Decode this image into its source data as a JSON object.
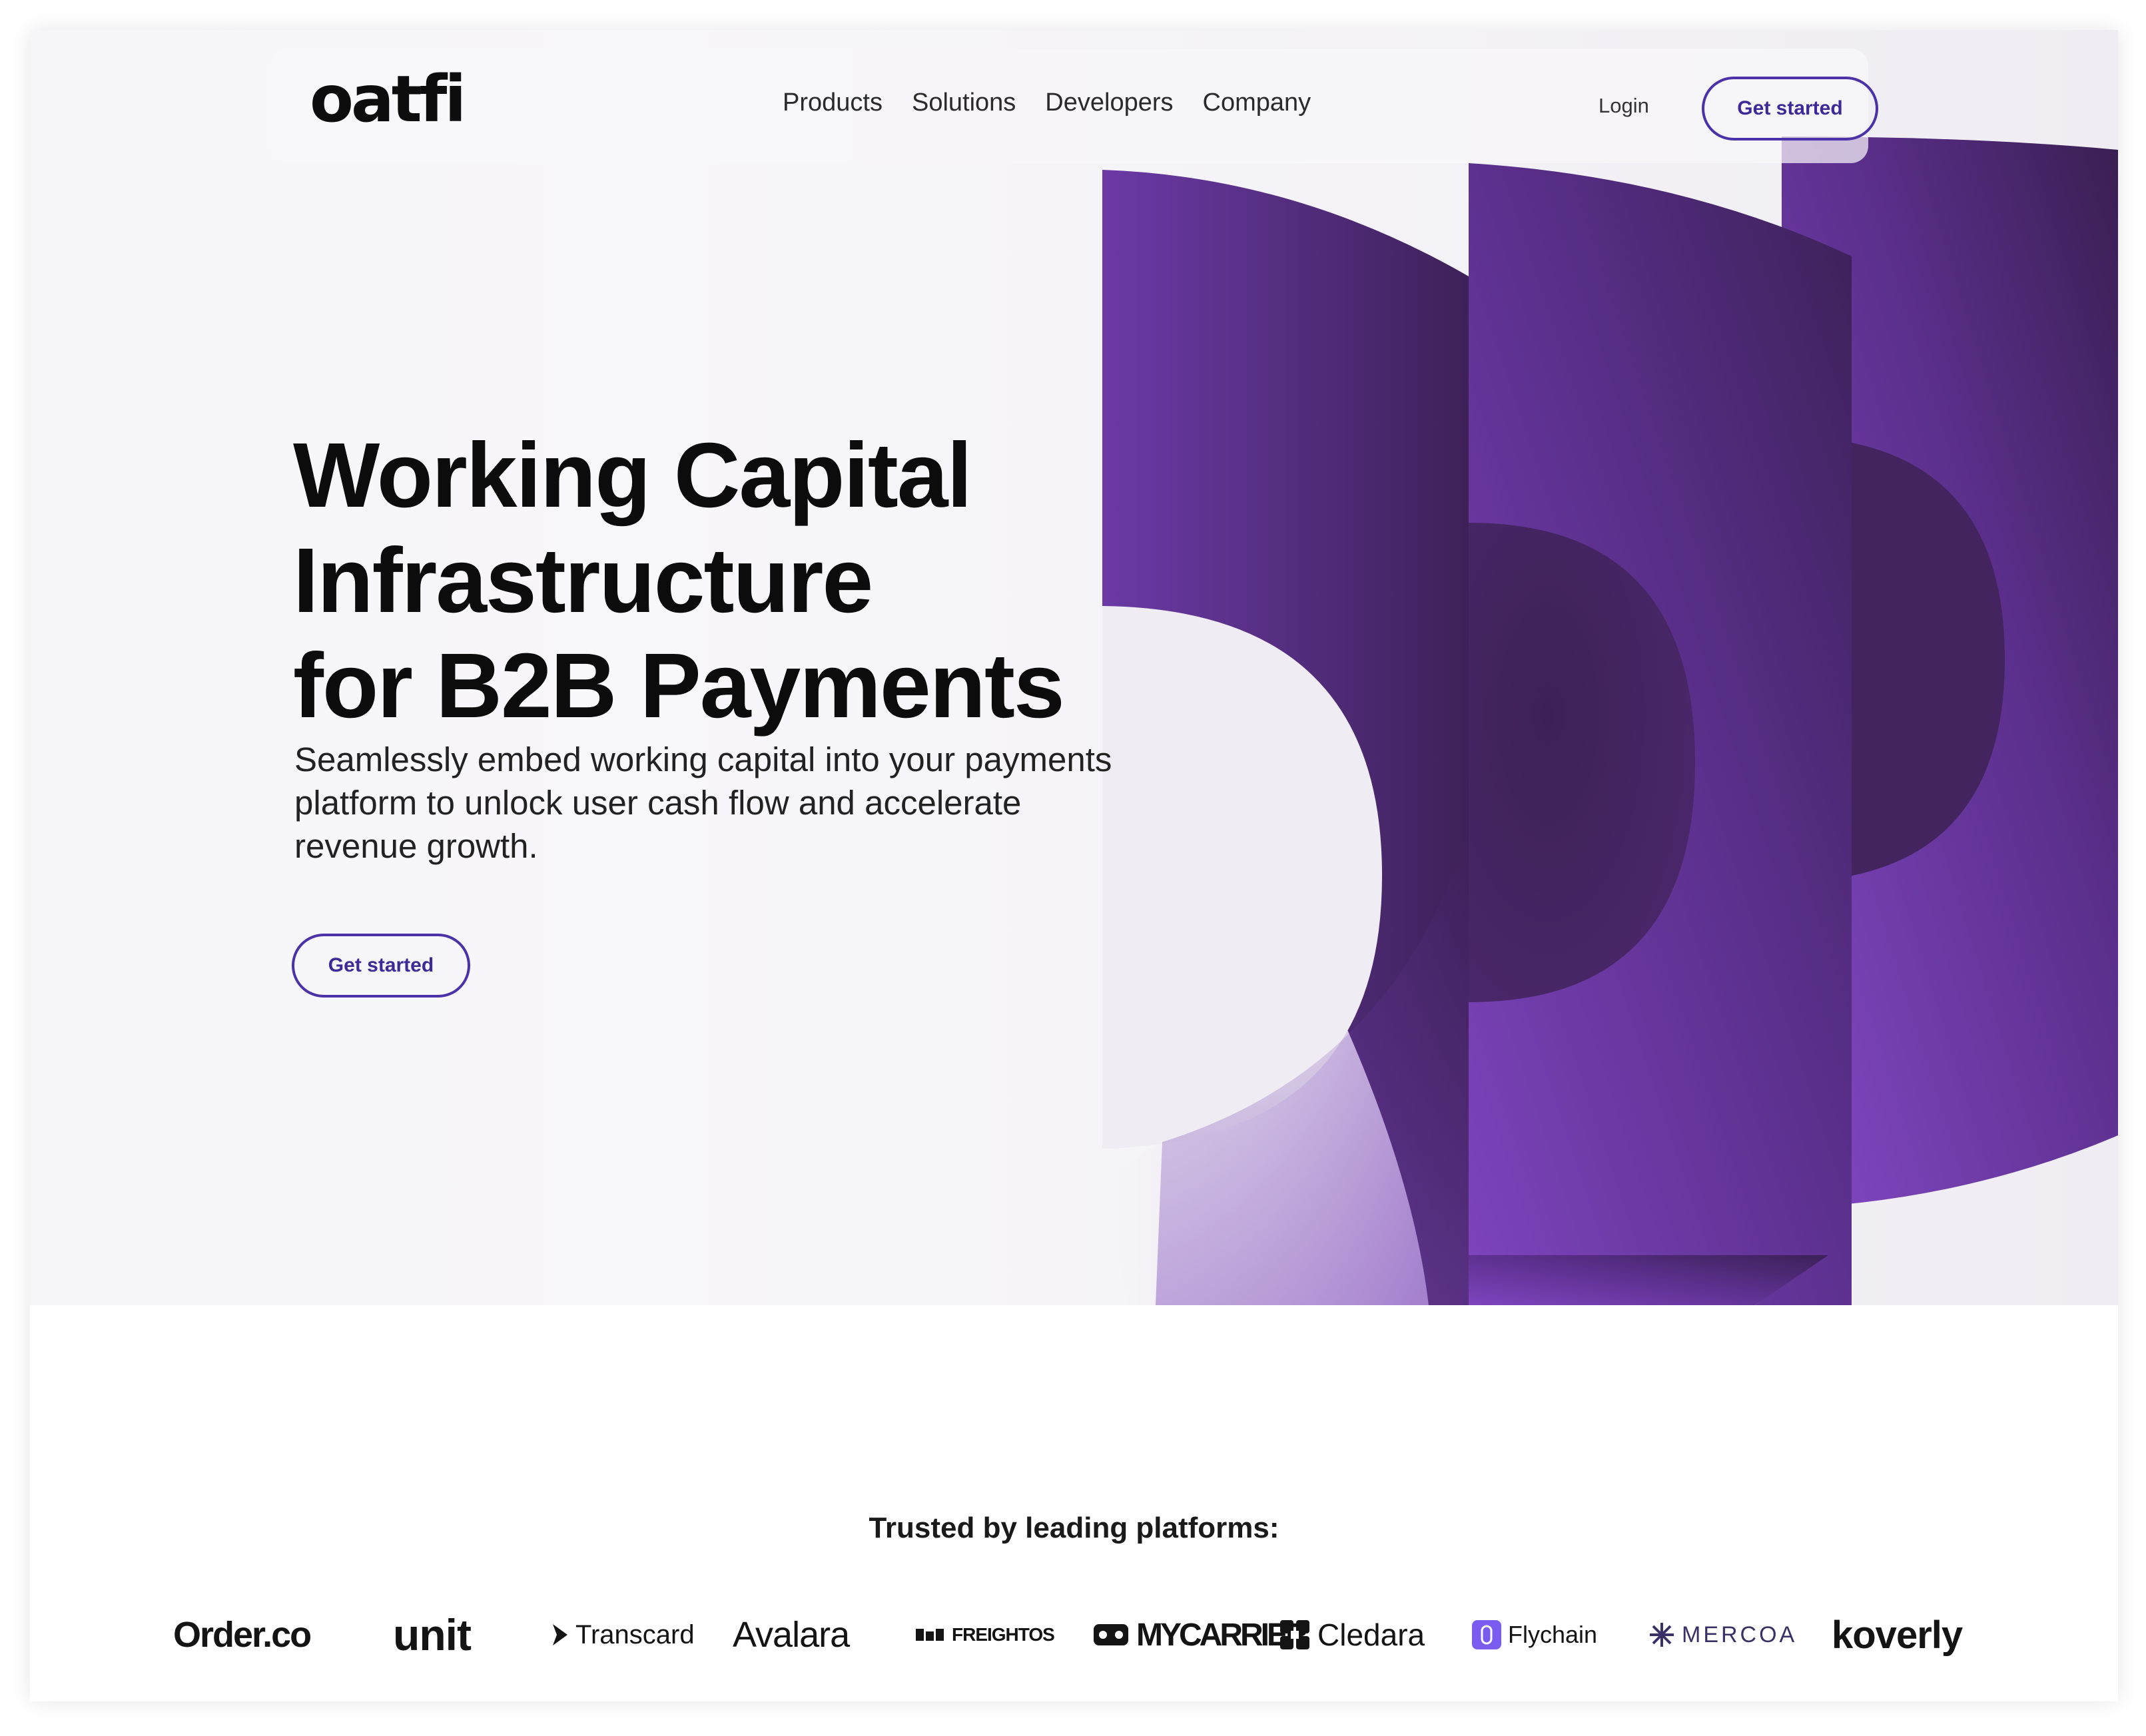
{
  "header": {
    "logo": "oatfi",
    "nav": [
      "Products",
      "Solutions",
      "Developers",
      "Company"
    ],
    "login": "Login",
    "cta": "Get started"
  },
  "hero": {
    "headline": [
      "Working Capital",
      "Infrastructure",
      "for B2B Payments"
    ],
    "subtitle": "Seamlessly embed working capital into your payments platform to unlock user cash flow and accelerate revenue growth.",
    "cta": "Get started"
  },
  "trusted": {
    "title": "Trusted by leading platforms:",
    "logos": [
      "Order.co",
      "unit",
      "Transcard",
      "Avalara",
      "FREIGHTOS",
      "MYCARRIER",
      "Cledara",
      "Flychain",
      "MERCOA",
      "koverly"
    ]
  },
  "colors": {
    "brand_purple": "#4b32a8",
    "shape_dark": "#3c2157",
    "shape_mid": "#5b2f8c",
    "shape_light": "#7a42b8",
    "hero_bg": "#f3f2f6"
  }
}
